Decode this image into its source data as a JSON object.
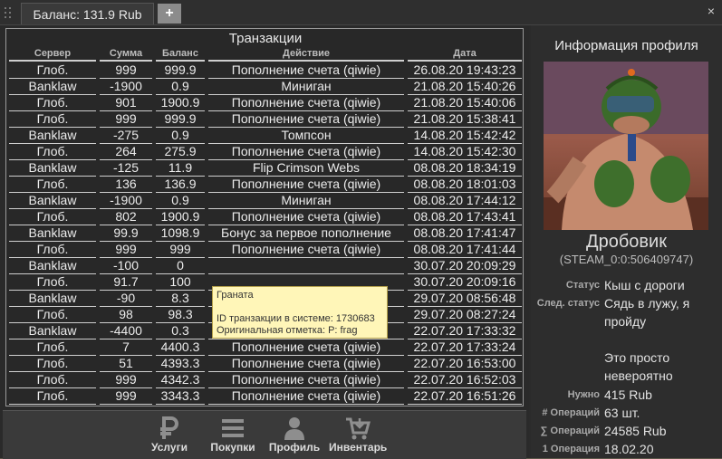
{
  "tab": {
    "title": "Баланс: 131.9 Rub",
    "add_label": "+"
  },
  "window": {
    "close_label": "×"
  },
  "transactions": {
    "title": "Транзакции",
    "columns": [
      "Сервер",
      "Сумма",
      "Баланс",
      "Действие",
      "Дата"
    ],
    "rows": [
      [
        "Глоб.",
        "999",
        "999.9",
        "Пополнение счета (qiwie)",
        "26.08.20 19:43:23"
      ],
      [
        "Banklaw",
        "-1900",
        "0.9",
        "Миниган",
        "21.08.20 15:40:26"
      ],
      [
        "Глоб.",
        "901",
        "1900.9",
        "Пополнение счета (qiwie)",
        "21.08.20 15:40:06"
      ],
      [
        "Глоб.",
        "999",
        "999.9",
        "Пополнение счета (qiwie)",
        "21.08.20 15:38:41"
      ],
      [
        "Banklaw",
        "-275",
        "0.9",
        "Томпсон",
        "14.08.20 15:42:42"
      ],
      [
        "Глоб.",
        "264",
        "275.9",
        "Пополнение счета (qiwie)",
        "14.08.20 15:42:30"
      ],
      [
        "Banklaw",
        "-125",
        "11.9",
        "Flip Crimson Webs",
        "08.08.20 18:34:19"
      ],
      [
        "Глоб.",
        "136",
        "136.9",
        "Пополнение счета (qiwie)",
        "08.08.20 18:01:03"
      ],
      [
        "Banklaw",
        "-1900",
        "0.9",
        "Миниган",
        "08.08.20 17:44:12"
      ],
      [
        "Глоб.",
        "802",
        "1900.9",
        "Пополнение счета (qiwie)",
        "08.08.20 17:43:41"
      ],
      [
        "Banklaw",
        "99.9",
        "1098.9",
        "Бонус за первое пополнение",
        "08.08.20 17:41:47"
      ],
      [
        "Глоб.",
        "999",
        "999",
        "Пополнение счета (qiwie)",
        "08.08.20 17:41:44"
      ],
      [
        "Banklaw",
        "-100",
        "0",
        "",
        "30.07.20 20:09:29"
      ],
      [
        "Глоб.",
        "91.7",
        "100",
        "",
        "30.07.20 20:09:16"
      ],
      [
        "Banklaw",
        "-90",
        "8.3",
        "",
        "29.07.20 08:56:48"
      ],
      [
        "Глоб.",
        "98",
        "98.3",
        "",
        "29.07.20 08:27:24"
      ],
      [
        "Banklaw",
        "-4400",
        "0.3",
        "Граната",
        "22.07.20 17:33:32"
      ],
      [
        "Глоб.",
        "7",
        "4400.3",
        "Пополнение счета (qiwie)",
        "22.07.20 17:33:24"
      ],
      [
        "Глоб.",
        "51",
        "4393.3",
        "Пополнение счета (qiwie)",
        "22.07.20 16:53:00"
      ],
      [
        "Глоб.",
        "999",
        "4342.3",
        "Пополнение счета (qiwie)",
        "22.07.20 16:52:03"
      ],
      [
        "Глоб.",
        "999",
        "3343.3",
        "Пополнение счета (qiwie)",
        "22.07.20 16:51:26"
      ]
    ]
  },
  "tooltip": {
    "title": "Граната",
    "tx_id": "ID транзакции в системе: 1730683",
    "note": "Оригинальная отметка: P: frag"
  },
  "nav": {
    "services": "Услуги",
    "purchases": "Покупки",
    "profile": "Профиль",
    "inventory": "Инвентарь"
  },
  "profile": {
    "header": "Информация профиля",
    "name": "Дробовик",
    "steam_id": "(STEAM_0:0:506409747)",
    "status_label": "Статус",
    "status_value": "Кыш с дороги",
    "next_status_label": "След. статус",
    "next_status_value": "Сядь в лужу, я пройду",
    "extra_text": "Это просто невероятно",
    "need_label": "Нужно",
    "need_value": "415 Rub",
    "ops_count_label": "# Операций",
    "ops_count_value": "63 шт.",
    "ops_sum_label": "∑ Операций",
    "ops_sum_value": "24585 Rub",
    "first_op_label": "1 Операция",
    "first_op_value": "18.02.20"
  },
  "colors": {
    "window_bg": "#2b2b2b",
    "text": "#ececec",
    "tooltip_bg": "#fff6b8",
    "tab_add_bg": "#8c8c8c"
  }
}
